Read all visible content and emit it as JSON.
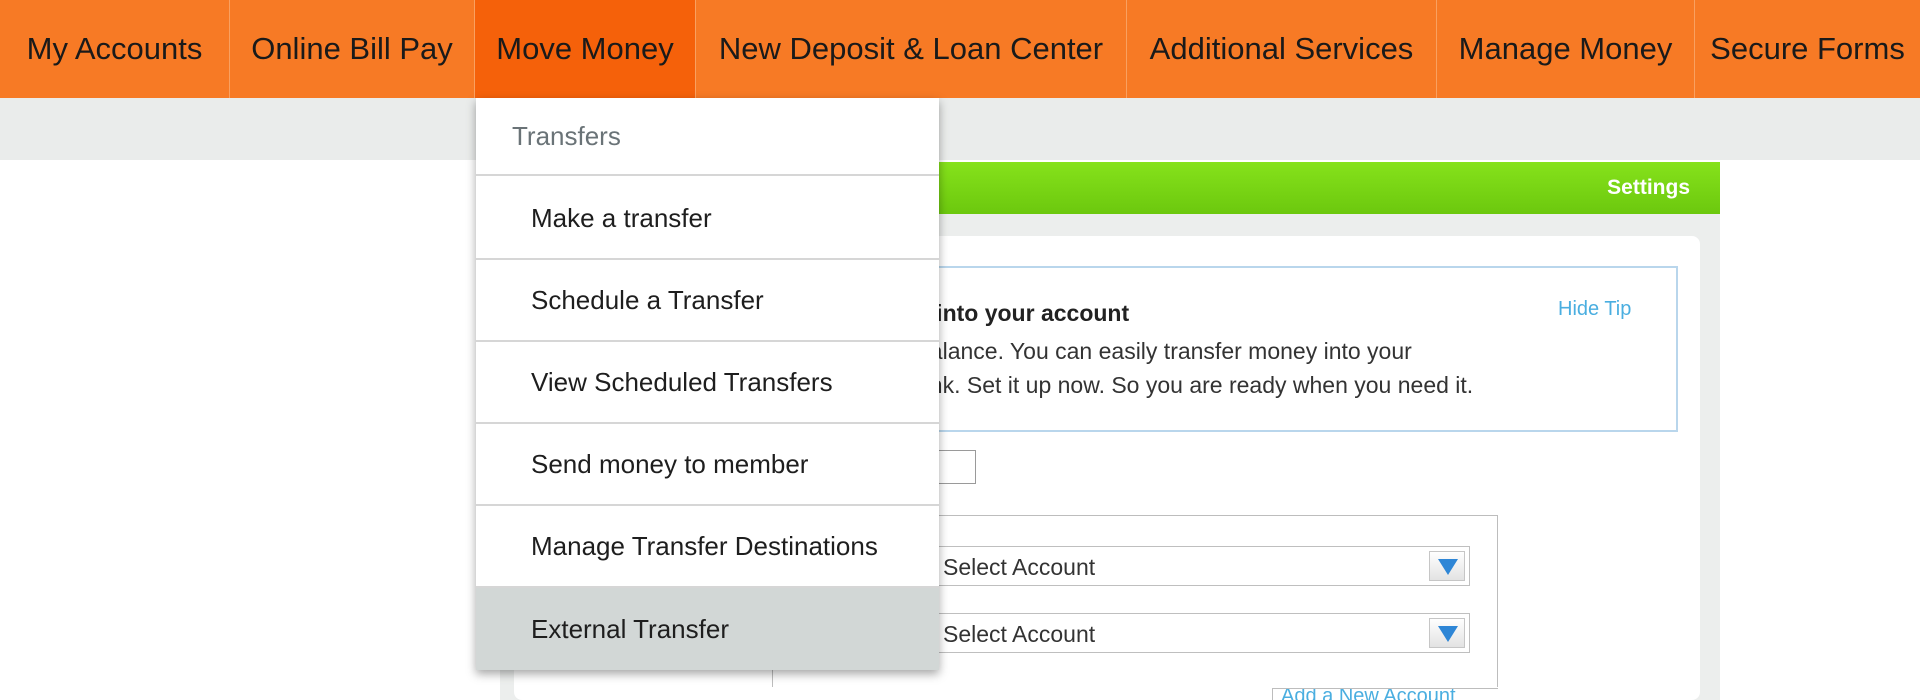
{
  "nav": {
    "items": [
      {
        "label": "My Accounts"
      },
      {
        "label": "Online Bill Pay"
      },
      {
        "label": "Move Money"
      },
      {
        "label": "New Deposit & Loan Center"
      },
      {
        "label": "Additional Services"
      },
      {
        "label": "Manage Money"
      },
      {
        "label": "Secure Forms"
      }
    ],
    "active_item": "Move Money"
  },
  "panel": {
    "settings_label": "Settings",
    "tip": {
      "title": "s into your account",
      "line1": "balance. You can easily transfer money into your",
      "line2": "ank. Set it up now. So you are ready when you need it.",
      "hide_label": "Hide Tip"
    },
    "from_select": {
      "value": "Select Account"
    },
    "to_select": {
      "value": "Select Account"
    },
    "add_new_label": "Add a New Account"
  },
  "dropdown": {
    "header": "Transfers",
    "items": [
      {
        "label": "Make a transfer"
      },
      {
        "label": "Schedule a Transfer"
      },
      {
        "label": "View Scheduled Transfers"
      },
      {
        "label": "Send money to member"
      },
      {
        "label": "Manage Transfer Destinations"
      },
      {
        "label": "External Transfer"
      }
    ],
    "highlighted_item": "External Transfer"
  },
  "colors": {
    "nav_bg": "#f77a25",
    "nav_active": "#f5610a",
    "green_bar": "#7ad414",
    "link_blue": "#4aaee0",
    "menu_highlight": "#d2d7d6"
  }
}
